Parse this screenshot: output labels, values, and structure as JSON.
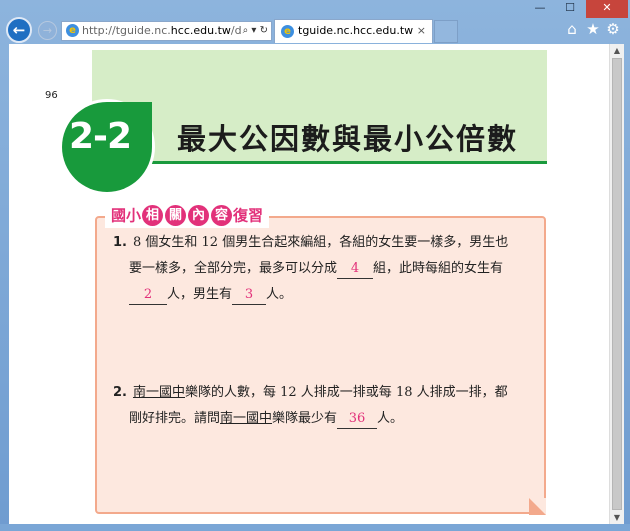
{
  "browser": {
    "window_controls": {
      "minimize": "—",
      "maximize": "☐",
      "close": "✕"
    },
    "address": {
      "prefix": "http://tguide.nc.",
      "host": "hcc.edu.tw",
      "suffix": "/dem",
      "tools": "⌕ ▾ ↻"
    },
    "tab": {
      "title": "tguide.nc.hcc.edu.tw",
      "close": "×"
    },
    "toolbar_icons": [
      "home-icon",
      "star-icon",
      "gear-icon"
    ]
  },
  "page": {
    "page_number": "96",
    "section_badge": "2-2",
    "section_title": "最大公因數與最小公倍數",
    "box_header": {
      "prefix": "國小",
      "circles": [
        "相",
        "關",
        "內",
        "容"
      ],
      "suffix": "復習"
    },
    "questions": [
      {
        "number": "1.",
        "line1": "8 個女生和 12 個男生合起來編組，各組的女生要一樣多，男生也",
        "line2_a": "要一樣多，全部分完，最多可以分成",
        "answer1": "4",
        "line2_b": "組，此時每組的女生有",
        "answer2": "2",
        "line3_a": "人，男生有",
        "answer3": "3",
        "line3_b": "人。"
      },
      {
        "number": "2.",
        "school1": "南一國中",
        "line1": "樂隊的人數，每 12 人排成一排或每 18 人排成一排，都",
        "line2_a": "剛好排完。請問",
        "school2": "南一國中",
        "line2_b": "樂隊最少有",
        "answer": "36",
        "line2_c": "人。"
      }
    ]
  },
  "colors": {
    "accent_green": "#189a3c",
    "accent_pink": "#e2317a",
    "box_fill": "#fde8df"
  }
}
